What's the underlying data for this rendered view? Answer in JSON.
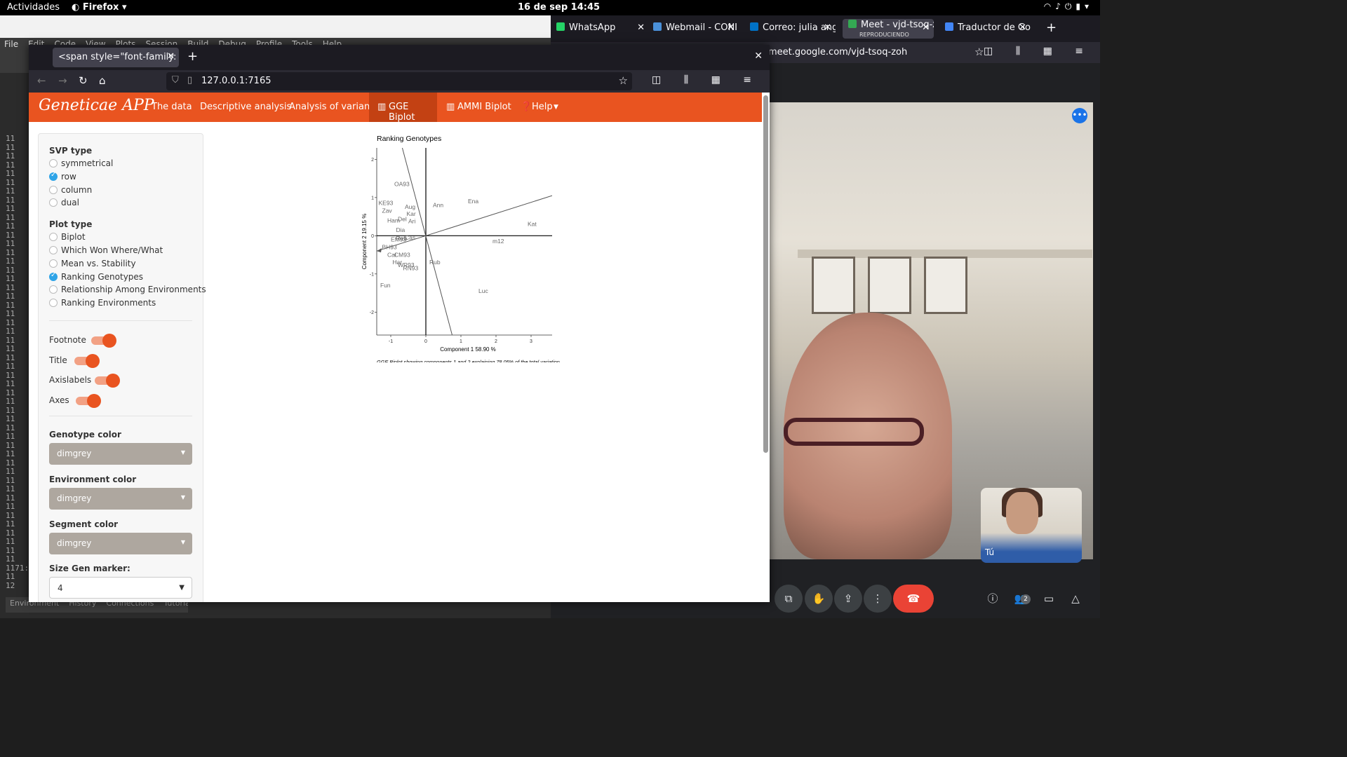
{
  "system": {
    "activities": "Actividades",
    "app_name": "Firefox",
    "clock": "16 de sep  14:45"
  },
  "rstudio": {
    "menu": [
      "File",
      "Edit",
      "Code",
      "View",
      "Plots",
      "Session",
      "Build",
      "Debug",
      "Profile",
      "Tools",
      "Help"
    ],
    "gutter_lines": [
      "11",
      "11",
      "11",
      "11",
      "11",
      "11",
      "11",
      "11",
      "11",
      "11",
      "11",
      "11",
      "11",
      "11",
      "11",
      "11",
      "11",
      "11",
      "11",
      "11",
      "11",
      "11",
      "11",
      "11",
      "11",
      "11",
      "11",
      "11",
      "11",
      "11",
      "11",
      "11",
      "11",
      "11",
      "11",
      "11",
      "11",
      "11",
      "11",
      "11",
      "11",
      "11",
      "11",
      "11",
      "11",
      "11",
      "11",
      "11",
      "11",
      "1171:",
      "11",
      "12"
    ],
    "bottom_tabs": [
      "Environment",
      "History",
      "Connections",
      "Tutorial"
    ]
  },
  "meet_browser": {
    "tabs": [
      {
        "label": "WhatsApp",
        "icon_color": "#25d366"
      },
      {
        "label": "Webmail - CONI",
        "icon_color": "#4a90d9"
      },
      {
        "label": "Correo: julia ange",
        "icon_color": "#0072c6"
      },
      {
        "label": "Meet - vjd-tsoq-z",
        "sub": "REPRODUCIENDO",
        "icon_color": "#34a853"
      },
      {
        "label": "Traductor de Goo",
        "icon_color": "#4285f4"
      }
    ],
    "url": "meet.google.com/vjd-tsoq-zoh",
    "self_name": "Tú",
    "participant_count": "2"
  },
  "firefox": {
    "tab_title": "<span style=\"font-family: Lob",
    "url": "127.0.0.1:7165"
  },
  "app": {
    "brand": "Geneticae APP",
    "nav": [
      "The data",
      "Descriptive analysis",
      "Analysis of variance",
      "GGE Biplot",
      "AMMI Biplot",
      "Help"
    ],
    "active_tab": "GGE Biplot",
    "accent_color": "#e95420",
    "svp_heading": "SVP type",
    "svp_options": [
      "symmetrical",
      "row",
      "column",
      "dual"
    ],
    "svp_selected": "row",
    "plot_heading": "Plot type",
    "plot_options": [
      "Biplot",
      "Which Won Where/What",
      "Mean vs. Stability",
      "Ranking Genotypes",
      "Relationship Among Environments",
      "Ranking Environments"
    ],
    "plot_selected": "Ranking Genotypes",
    "toggles": [
      {
        "label": "Footnote",
        "on": true
      },
      {
        "label": "Title",
        "on": true
      },
      {
        "label": "Axislabels",
        "on": true
      },
      {
        "label": "Axes",
        "on": true
      }
    ],
    "genotype_color_label": "Genotype color",
    "genotype_color": "dimgrey",
    "environment_color_label": "Environment color",
    "environment_color": "dimgrey",
    "segment_color_label": "Segment color",
    "segment_color": "dimgrey",
    "size_gen_label": "Size Gen marker:",
    "size_gen_value": "4"
  },
  "chart_data": {
    "type": "scatter",
    "title": "Ranking Genotypes",
    "xlabel": "Component 1 58.90 %",
    "ylabel": "Component 2 19.15 %",
    "xlim": [
      -1.4,
      3.6
    ],
    "ylim": [
      -2.6,
      2.3
    ],
    "xticks": [
      -1,
      0,
      1,
      2,
      3
    ],
    "yticks": [
      -2,
      -1,
      0,
      1,
      2
    ],
    "genotypes": [
      {
        "label": "OA93",
        "x": -0.9,
        "y": 1.3
      },
      {
        "label": "KE93",
        "x": -1.35,
        "y": 0.8
      },
      {
        "label": "Zav",
        "x": -1.25,
        "y": 0.6
      },
      {
        "label": "Aug",
        "x": -0.6,
        "y": 0.7
      },
      {
        "label": "Kar",
        "x": -0.55,
        "y": 0.52
      },
      {
        "label": "Ham",
        "x": -1.1,
        "y": 0.35
      },
      {
        "label": "Del",
        "x": -0.8,
        "y": 0.38
      },
      {
        "label": "Ari",
        "x": -0.5,
        "y": 0.33
      },
      {
        "label": "Dia",
        "x": -0.85,
        "y": 0.1
      },
      {
        "label": "EM93",
        "x": -1.0,
        "y": -0.15
      },
      {
        "label": "Reb",
        "x": -0.85,
        "y": -0.12
      },
      {
        "label": "Cas",
        "x": -0.6,
        "y": -0.1
      },
      {
        "label": "BH93",
        "x": -1.25,
        "y": -0.35
      },
      {
        "label": "Cal",
        "x": -1.1,
        "y": -0.55
      },
      {
        "label": "CM93",
        "x": -0.9,
        "y": -0.55
      },
      {
        "label": "Har",
        "x": -0.95,
        "y": -0.75
      },
      {
        "label": "WR93",
        "x": -0.8,
        "y": -0.82
      },
      {
        "label": "RN93",
        "x": -0.65,
        "y": -0.9
      },
      {
        "label": "Ena",
        "x": 1.2,
        "y": 0.85
      },
      {
        "label": "Ann",
        "x": 0.2,
        "y": 0.75
      },
      {
        "label": "Kat",
        "x": 2.9,
        "y": 0.25
      },
      {
        "label": "m12",
        "x": 1.9,
        "y": -0.2
      },
      {
        "label": "Rub",
        "x": 0.1,
        "y": -0.75
      },
      {
        "label": "Fun",
        "x": -1.3,
        "y": -1.35
      },
      {
        "label": "Luc",
        "x": 1.5,
        "y": -1.5
      }
    ],
    "ate_axis": {
      "x1": -1.4,
      "y1": -0.4,
      "x2": 3.6,
      "y2": 1.05
    },
    "ate_perpendicular": {
      "x1": -0.7,
      "y1": 2.4,
      "x2": 0.75,
      "y2": -2.6
    },
    "footnote": "GGE Biplot showing components 1 and 2 explaining 78.05% of the total variation using Row Metric Preserving SVP and Tester-Centered G+GE with no scaling"
  }
}
